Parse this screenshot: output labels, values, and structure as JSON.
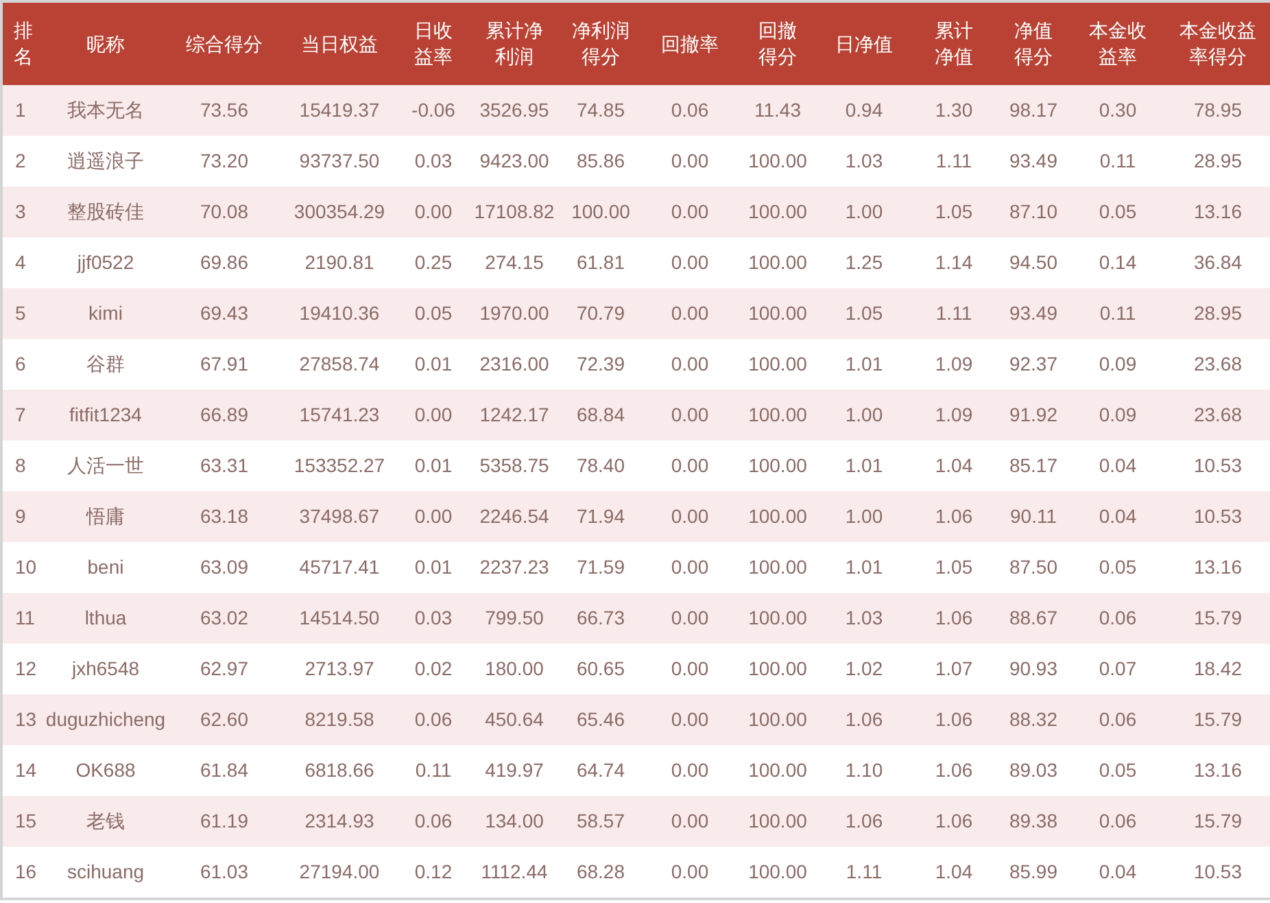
{
  "table": {
    "columns": [
      "排名",
      "昵称",
      "综合得分",
      "当日权益",
      "日收益率",
      "累计净利润",
      "净利润得分",
      "回撤率",
      "回撤得分",
      "日净值",
      "累计净值",
      "净值得分",
      "本金收益率",
      "本金收益率得分"
    ],
    "rows": [
      [
        "1",
        "我本无名",
        "73.56",
        "15419.37",
        "-0.06",
        "3526.95",
        "74.85",
        "0.06",
        "11.43",
        "0.94",
        "1.30",
        "98.17",
        "0.30",
        "78.95"
      ],
      [
        "2",
        "逍遥浪子",
        "73.20",
        "93737.50",
        "0.03",
        "9423.00",
        "85.86",
        "0.00",
        "100.00",
        "1.03",
        "1.11",
        "93.49",
        "0.11",
        "28.95"
      ],
      [
        "3",
        "整股砖佳",
        "70.08",
        "300354.29",
        "0.00",
        "17108.82",
        "100.00",
        "0.00",
        "100.00",
        "1.00",
        "1.05",
        "87.10",
        "0.05",
        "13.16"
      ],
      [
        "4",
        "jjf0522",
        "69.86",
        "2190.81",
        "0.25",
        "274.15",
        "61.81",
        "0.00",
        "100.00",
        "1.25",
        "1.14",
        "94.50",
        "0.14",
        "36.84"
      ],
      [
        "5",
        "kimi",
        "69.43",
        "19410.36",
        "0.05",
        "1970.00",
        "70.79",
        "0.00",
        "100.00",
        "1.05",
        "1.11",
        "93.49",
        "0.11",
        "28.95"
      ],
      [
        "6",
        "谷群",
        "67.91",
        "27858.74",
        "0.01",
        "2316.00",
        "72.39",
        "0.00",
        "100.00",
        "1.01",
        "1.09",
        "92.37",
        "0.09",
        "23.68"
      ],
      [
        "7",
        "fitfit1234",
        "66.89",
        "15741.23",
        "0.00",
        "1242.17",
        "68.84",
        "0.00",
        "100.00",
        "1.00",
        "1.09",
        "91.92",
        "0.09",
        "23.68"
      ],
      [
        "8",
        "人活一世",
        "63.31",
        "153352.27",
        "0.01",
        "5358.75",
        "78.40",
        "0.00",
        "100.00",
        "1.01",
        "1.04",
        "85.17",
        "0.04",
        "10.53"
      ],
      [
        "9",
        "悟庸",
        "63.18",
        "37498.67",
        "0.00",
        "2246.54",
        "71.94",
        "0.00",
        "100.00",
        "1.00",
        "1.06",
        "90.11",
        "0.04",
        "10.53"
      ],
      [
        "10",
        "beni",
        "63.09",
        "45717.41",
        "0.01",
        "2237.23",
        "71.59",
        "0.00",
        "100.00",
        "1.01",
        "1.05",
        "87.50",
        "0.05",
        "13.16"
      ],
      [
        "11",
        "lthua",
        "63.02",
        "14514.50",
        "0.03",
        "799.50",
        "66.73",
        "0.00",
        "100.00",
        "1.03",
        "1.06",
        "88.67",
        "0.06",
        "15.79"
      ],
      [
        "12",
        "jxh6548",
        "62.97",
        "2713.97",
        "0.02",
        "180.00",
        "60.65",
        "0.00",
        "100.00",
        "1.02",
        "1.07",
        "90.93",
        "0.07",
        "18.42"
      ],
      [
        "13",
        "duguzhicheng",
        "62.60",
        "8219.58",
        "0.06",
        "450.64",
        "65.46",
        "0.00",
        "100.00",
        "1.06",
        "1.06",
        "88.32",
        "0.06",
        "15.79"
      ],
      [
        "14",
        "OK688",
        "61.84",
        "6818.66",
        "0.11",
        "419.97",
        "64.74",
        "0.00",
        "100.00",
        "1.10",
        "1.06",
        "89.03",
        "0.05",
        "13.16"
      ],
      [
        "15",
        "老钱",
        "61.19",
        "2314.93",
        "0.06",
        "134.00",
        "58.57",
        "0.00",
        "100.00",
        "1.06",
        "1.06",
        "89.38",
        "0.06",
        "15.79"
      ],
      [
        "16",
        "scihuang",
        "61.03",
        "27194.00",
        "0.12",
        "1112.44",
        "68.28",
        "0.00",
        "100.00",
        "1.11",
        "1.04",
        "85.99",
        "0.04",
        "10.53"
      ]
    ]
  }
}
